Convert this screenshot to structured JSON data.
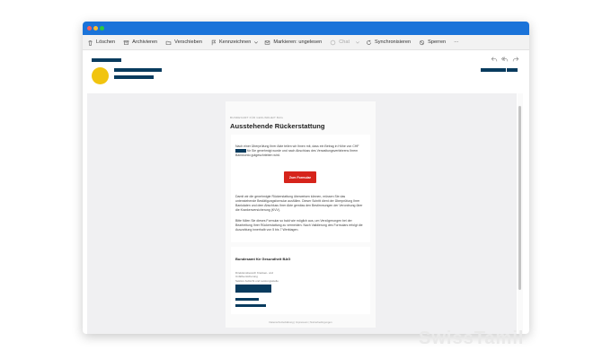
{
  "toolbar": {
    "delete": "Löschen",
    "archive": "Archivieren",
    "move": "Verschieben",
    "flag": "Kennzeichnen",
    "mark_unread": "Markieren: ungelesen",
    "chat": "Chat",
    "sync": "Synchronisieren",
    "block": "Sperren",
    "more": "···"
  },
  "email": {
    "kicker": "BUNDESAMT FÜR GESUNDHEIT BAG",
    "title": "Ausstehende Rückerstattung",
    "p1_a": "Nach einer Überprüfung Ihrer Akte teilen wir Ihnen mit, dass ein Betrag in Höhe von CHF",
    "p1_b": "für Sie genehmigt wurde und nach Abschluss des Verwaltungsverfahrens Ihrem Bankkonto gutgeschrieben wird.",
    "cta_label": "Zum Formular",
    "p2": "Damit wir die genehmigte Rückerstattung überweisen können, müssen Sie das untenstehende Bestätigungsformular ausfüllen. Dieser Schritt dient der Überprüfung Ihrer Bankdaten und dem Abschluss Ihrer Akte gemäss den Bestimmungen der Verordnung über die Krankenversicherung (KVV).",
    "p3": "Bitte füllen Sie dieses Formular so bald wie möglich aus, um Verzögerungen bei der Bearbeitung Ihrer Rückerstattung zu vermeiden. Nach Validierung des Formulars erfolgt die Auszahlung innerhalb von 5 bis 7 Werktagen.",
    "org": "Bundesamt für Gesundheit BAG",
    "dept_1": "Direktionsbereich Kranken- und",
    "dept_2": "Unfallversicherung",
    "dept_3": "Sektion Aufsicht und Leistungsstelle",
    "footer": "Datenschutzerklärung  |  Impressum  |  Nutzerbedingungen"
  },
  "watermark": "SwissTamil"
}
